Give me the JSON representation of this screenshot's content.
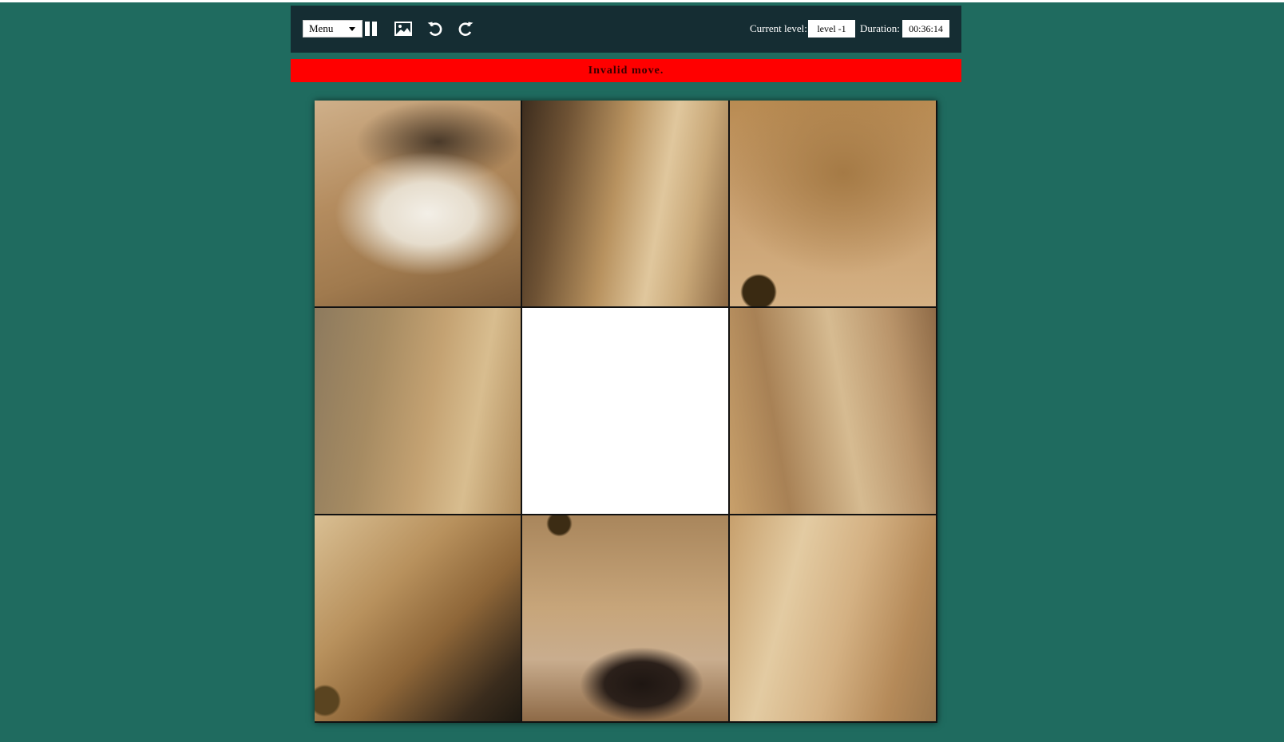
{
  "toolbar": {
    "menu_label": "Menu",
    "icons": [
      "pause-icon",
      "image-icon",
      "undo-icon",
      "redo-icon"
    ],
    "current_level_label": "Current level:",
    "current_level_value": "level -1",
    "duration_label": "Duration:",
    "duration_value": "00:36:14"
  },
  "status_message": "Invalid move.",
  "colors": {
    "background": "#1f6b5f",
    "toolbar": "#152d33",
    "alert": "#ff0000"
  },
  "puzzle": {
    "grid_size": 3,
    "empty_tile_index": 4,
    "tiles": [
      "lion-muzzle-chin-tile",
      "lion-mane-tile",
      "lion-forehead-eye-tile",
      "lion-cheek-tile",
      "empty-tile",
      "lion-whiskers-tile",
      "lion-mane-eye-tile",
      "lion-nose-tile",
      "lion-mane-light-tile"
    ]
  }
}
